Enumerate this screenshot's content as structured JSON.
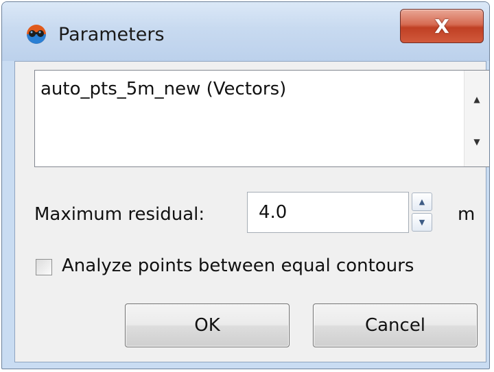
{
  "window": {
    "title": "Parameters",
    "app_icon": "parameters-app-icon",
    "close_label": "X"
  },
  "vectors_list": {
    "items": [
      "auto_pts_5m_new (Vectors)"
    ],
    "scroll_up_icon": "scroll-up-arrow-icon",
    "scroll_down_icon": "scroll-down-arrow-icon"
  },
  "max_residual": {
    "label": "Maximum residual:",
    "value": "4.0",
    "unit": "m",
    "spin_up_icon": "spin-up-icon",
    "spin_down_icon": "spin-down-icon"
  },
  "analyze_checkbox": {
    "label": "Analyze points between equal contours",
    "checked": false
  },
  "buttons": {
    "ok_label": "OK",
    "cancel_label": "Cancel"
  }
}
